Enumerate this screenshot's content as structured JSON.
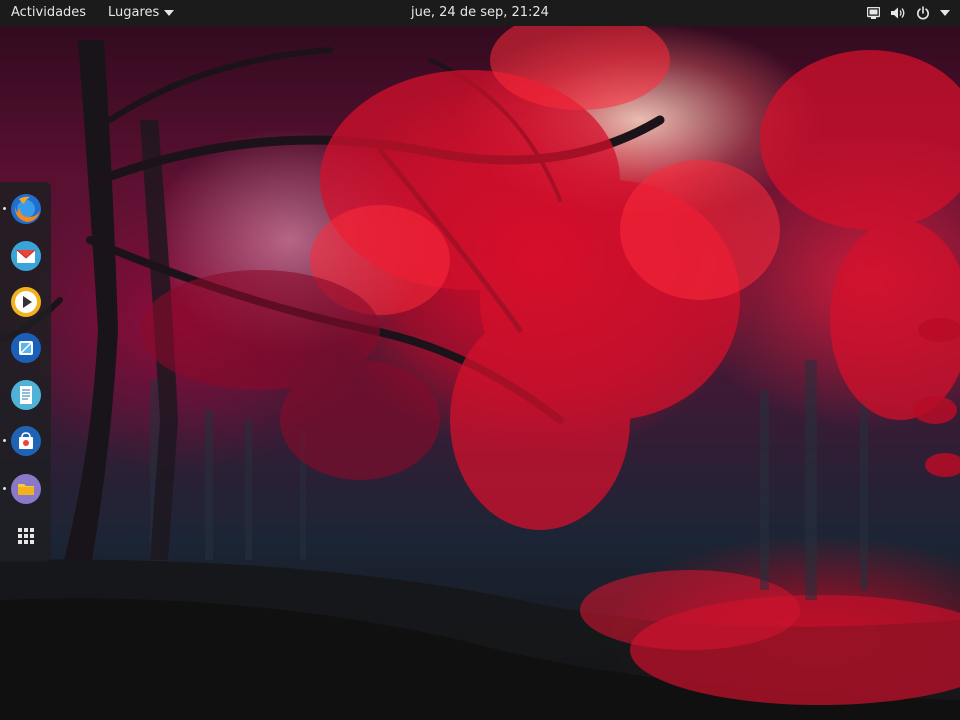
{
  "topbar": {
    "activities_label": "Actividades",
    "places_label": "Lugares",
    "clock": "jue, 24 de sep, 21:24",
    "status_icons": [
      "display-icon",
      "volume-icon",
      "power-icon",
      "chevron-down-icon"
    ]
  },
  "dock": {
    "apps": [
      {
        "name": "firefox",
        "icon": "firefox-icon",
        "running": true
      },
      {
        "name": "mail",
        "icon": "mail-icon",
        "running": false
      },
      {
        "name": "media-player",
        "icon": "media-player-icon",
        "running": false
      },
      {
        "name": "app-store",
        "icon": "app-store-icon",
        "running": false
      },
      {
        "name": "text-editor",
        "icon": "text-editor-icon",
        "running": false
      },
      {
        "name": "software",
        "icon": "software-icon",
        "running": true
      },
      {
        "name": "files",
        "icon": "files-icon",
        "running": true
      }
    ],
    "show_apps_icon": "app-grid-icon"
  },
  "colors": {
    "topbar_bg": "#1b1b1b",
    "topbar_text": "#e6e6e6",
    "wallpaper_accent": "#e0102e"
  }
}
